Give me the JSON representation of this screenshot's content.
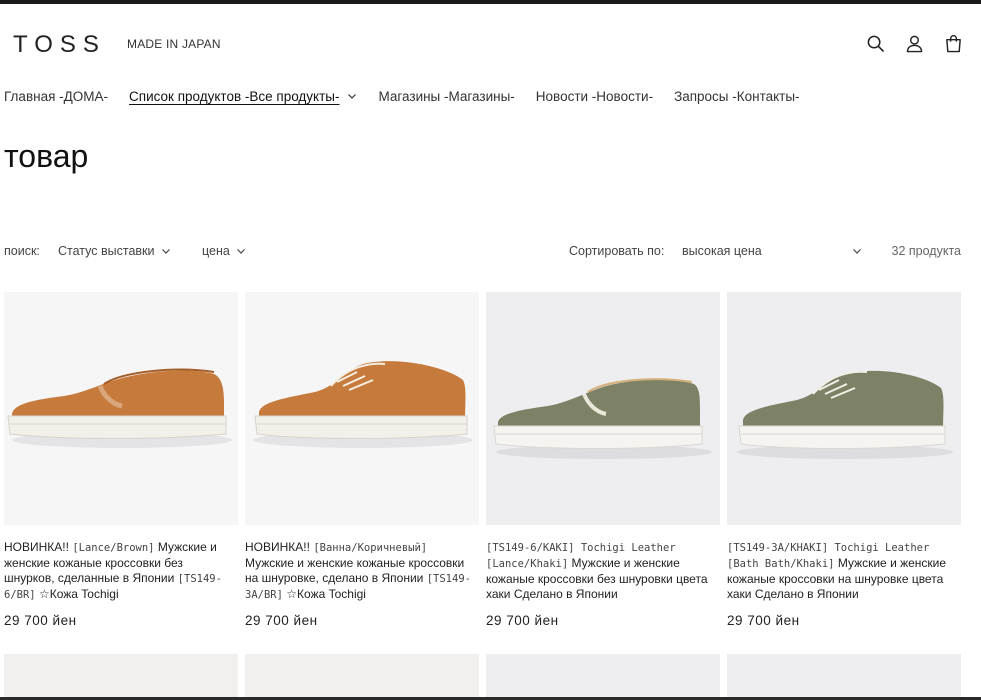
{
  "header": {
    "logo": "TOSS",
    "tagline": "MADE IN JAPAN",
    "icons": [
      "search-icon",
      "account-icon",
      "cart-icon"
    ]
  },
  "nav": {
    "items": [
      {
        "label": "Главная -ДОМА-"
      },
      {
        "label": "Список продуктов -Все продукты-"
      },
      {
        "label": "Магазины -Магазины-"
      },
      {
        "label": "Новости -Новости-"
      },
      {
        "label": "Запросы -Контакты-"
      }
    ]
  },
  "page": {
    "title": "товар"
  },
  "filters": {
    "label": "поиск:",
    "status": "Статус выставки",
    "price": "цена",
    "sort_label": "Сортировать по:",
    "sort_value": "высокая цена",
    "count": "32 продукта"
  },
  "products": [
    {
      "badge": "НОВИНКА!!",
      "code": "[Lance/Brown]",
      "name": "Мужские и женские кожаные кроссовки без шнурков, сделанные в Японии",
      "code2": "[TS149-6/BR]",
      "suffix": "☆Кожа Tochigi",
      "price": "29 700 йен",
      "colors": {
        "upper": "#c8783a",
        "sole": "#f4f1ec",
        "bg": "#f7f7f8"
      }
    },
    {
      "badge": "НОВИНКА!!",
      "code": "[Ванна/Коричневый]",
      "name": "Мужские и женские кожаные кроссовки на шнуровке, сделано в Японии",
      "code2": "[TS149-3A/BR]",
      "suffix": "☆Кожа Tochigi",
      "price": "29 700 йен",
      "colors": {
        "upper": "#c8783a",
        "sole": "#f4f1ec",
        "bg": "#f7f7f8"
      }
    },
    {
      "badge": "",
      "code": "[TS149-6/KAKI] Tochigi Leather [Lance/Khaki]",
      "name": "Мужские и женские кожаные кроссовки без шнуровки цвета хаки Сделано в Японии",
      "code2": "",
      "suffix": "",
      "price": "29 700 йен",
      "colors": {
        "upper": "#7c8064",
        "sole": "#f4f3ef",
        "bg": "#eeedf0"
      }
    },
    {
      "badge": "",
      "code": "[TS149-3A/KHAKI] Tochigi Leather [Bath Bath/Khaki]",
      "name": "Мужские и женские кожаные кроссовки на шнуровке цвета хаки Сделано в Японии",
      "code2": "",
      "suffix": "",
      "price": "29 700 йен",
      "colors": {
        "upper": "#7c8064",
        "sole": "#f4f3ef",
        "bg": "#eeedf0"
      }
    }
  ]
}
